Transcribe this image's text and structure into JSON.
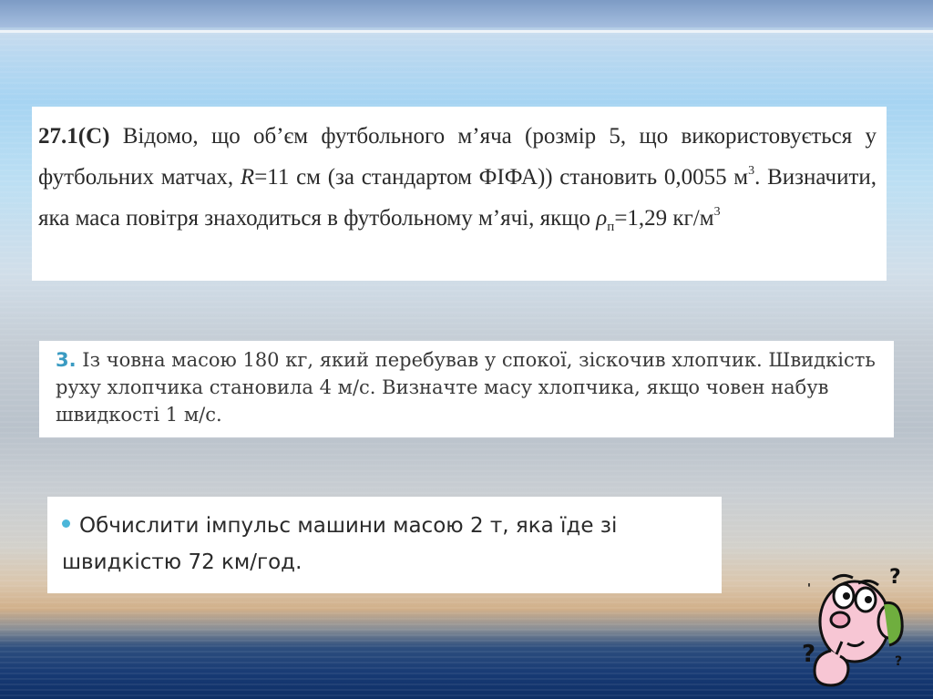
{
  "problem1": {
    "number": "27.1(С)",
    "text_a": " Відомо, що об’єм футбольного м’яча (розмір 5, що використовується у футбольних матчах, ",
    "r_symbol": "R",
    "text_b": "=11 см (за стандартом ФІФА)) становить 0,0055 м",
    "exp1": "3",
    "text_c": ". Визначити, яка маса повітря знаходиться в футбольному м’ячі, якщо ",
    "rho": "ρ",
    "rho_sub": "п",
    "text_d": "=1,29 кг/м",
    "exp2": "3"
  },
  "problem2": {
    "number": "3.",
    "text": " Із човна масою 180 кг, який перебував у спокої, зіскочив хлопчик. Швидкість руху хлопчика становила 4 м/с. Визначте масу хлопчика, якщо човен набув швидкості 1 м/с."
  },
  "problem3": {
    "text": "Обчислити імпульс машини масою 2 т, яка їде зі швидкістю 72 км/год."
  },
  "colors": {
    "bullet": "#4bb6d9",
    "number_accent": "#3a9bc2"
  },
  "icons": {
    "cartoon": "thinking-man-question-marks"
  }
}
